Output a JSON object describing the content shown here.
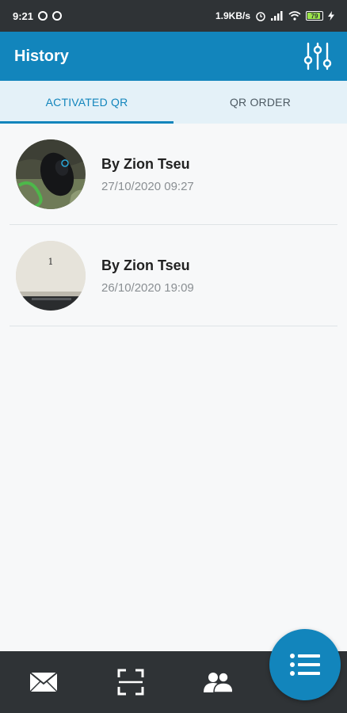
{
  "status_bar": {
    "time": "9:21",
    "network_speed": "1.9KB/s",
    "battery_level": "79",
    "icons": [
      "notification-icon",
      "notification-icon",
      "alarm-icon",
      "signal-icon",
      "wifi-icon",
      "battery-icon",
      "charging-icon"
    ]
  },
  "header": {
    "title": "History",
    "filter_icon": "sliders-icon"
  },
  "tabs": [
    {
      "label": "ACTIVATED QR",
      "active": true
    },
    {
      "label": "QR ORDER",
      "active": false
    }
  ],
  "history": [
    {
      "name": "By Zion Tseu",
      "date": "27/10/2020 09:27",
      "thumbnail": "mouse-photo"
    },
    {
      "name": "By Zion Tseu",
      "date": "26/10/2020 19:09",
      "thumbnail": "paper-photo",
      "thumbnail_text": "1"
    }
  ],
  "bottom_nav": {
    "items": [
      "mail-icon",
      "scan-icon",
      "people-icon"
    ],
    "fab_icon": "list-icon"
  },
  "colors": {
    "primary": "#1285bc",
    "dark": "#2f3336",
    "tab_bg": "#e4f1f8"
  }
}
